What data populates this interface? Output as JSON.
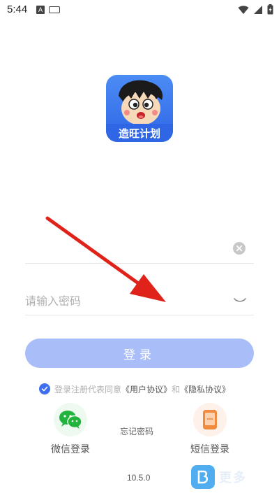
{
  "status_bar": {
    "time": "5:44",
    "notif_icon": "A"
  },
  "app": {
    "logo_text": "造旺计划"
  },
  "form": {
    "username_value": "",
    "password_placeholder": "请输入密码",
    "login_label": "登录"
  },
  "agreement": {
    "prefix": "登录注册代表同意",
    "user_agreement": "《用户协议》",
    "and": "和",
    "privacy_policy": "《隐私协议》"
  },
  "social": {
    "wechat_label": "微信登录",
    "sms_label": "短信登录"
  },
  "forgot_password": "忘记密码",
  "version": "10.5.0",
  "watermark": {
    "text": "更多"
  },
  "colors": {
    "primary": "#3d6ff0",
    "login_button": "#a9bef8",
    "logo_bg": "#3b7bf0",
    "wechat": "#22b33c",
    "sms": "#f08a3c",
    "arrow": "#e0231a"
  }
}
